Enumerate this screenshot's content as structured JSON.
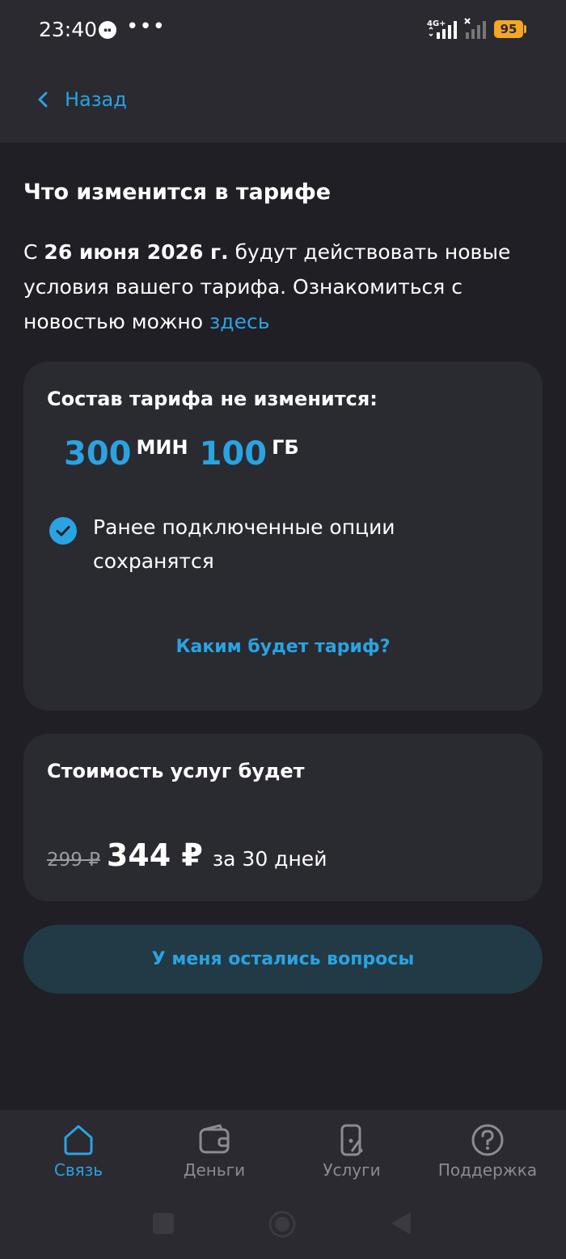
{
  "status_bar": {
    "time": "23:40",
    "battery": "95",
    "network": "4G+"
  },
  "nav": {
    "back_label": "Назад"
  },
  "headline": "Что изменится в тарифе",
  "intro": {
    "prefix": "С",
    "date": "26 июня 2026 г.",
    "text": "будут действовать новые условия вашего тарифа. Ознакомиться с новостью можно",
    "link": "здесь"
  },
  "composition_card": {
    "title": "Состав тарифа не изменится:",
    "minutes_value": "300",
    "minutes_unit": "МИН",
    "data_value": "100",
    "data_unit": "ГБ",
    "options_text": "Ранее подключенные опции сохранятся",
    "tariff_link": "Каким будет тариф?"
  },
  "price_card": {
    "title": "Стоимость услуг будет",
    "old_price": "299 ₽",
    "new_price": "344 ₽",
    "period": "за 30 дней"
  },
  "questions_button": "У меня остались вопросы",
  "tabs": [
    {
      "label": "Связь",
      "icon": "home-icon",
      "active": true
    },
    {
      "label": "Деньги",
      "icon": "wallet-icon",
      "active": false
    },
    {
      "label": "Услуги",
      "icon": "percent-phone-icon",
      "active": false
    },
    {
      "label": "Поддержка",
      "icon": "question-icon",
      "active": false
    }
  ],
  "colors": {
    "accent": "#2aa3e2",
    "background": "#1f1f25",
    "card": "#2a2a31",
    "battery": "#f5a623"
  }
}
